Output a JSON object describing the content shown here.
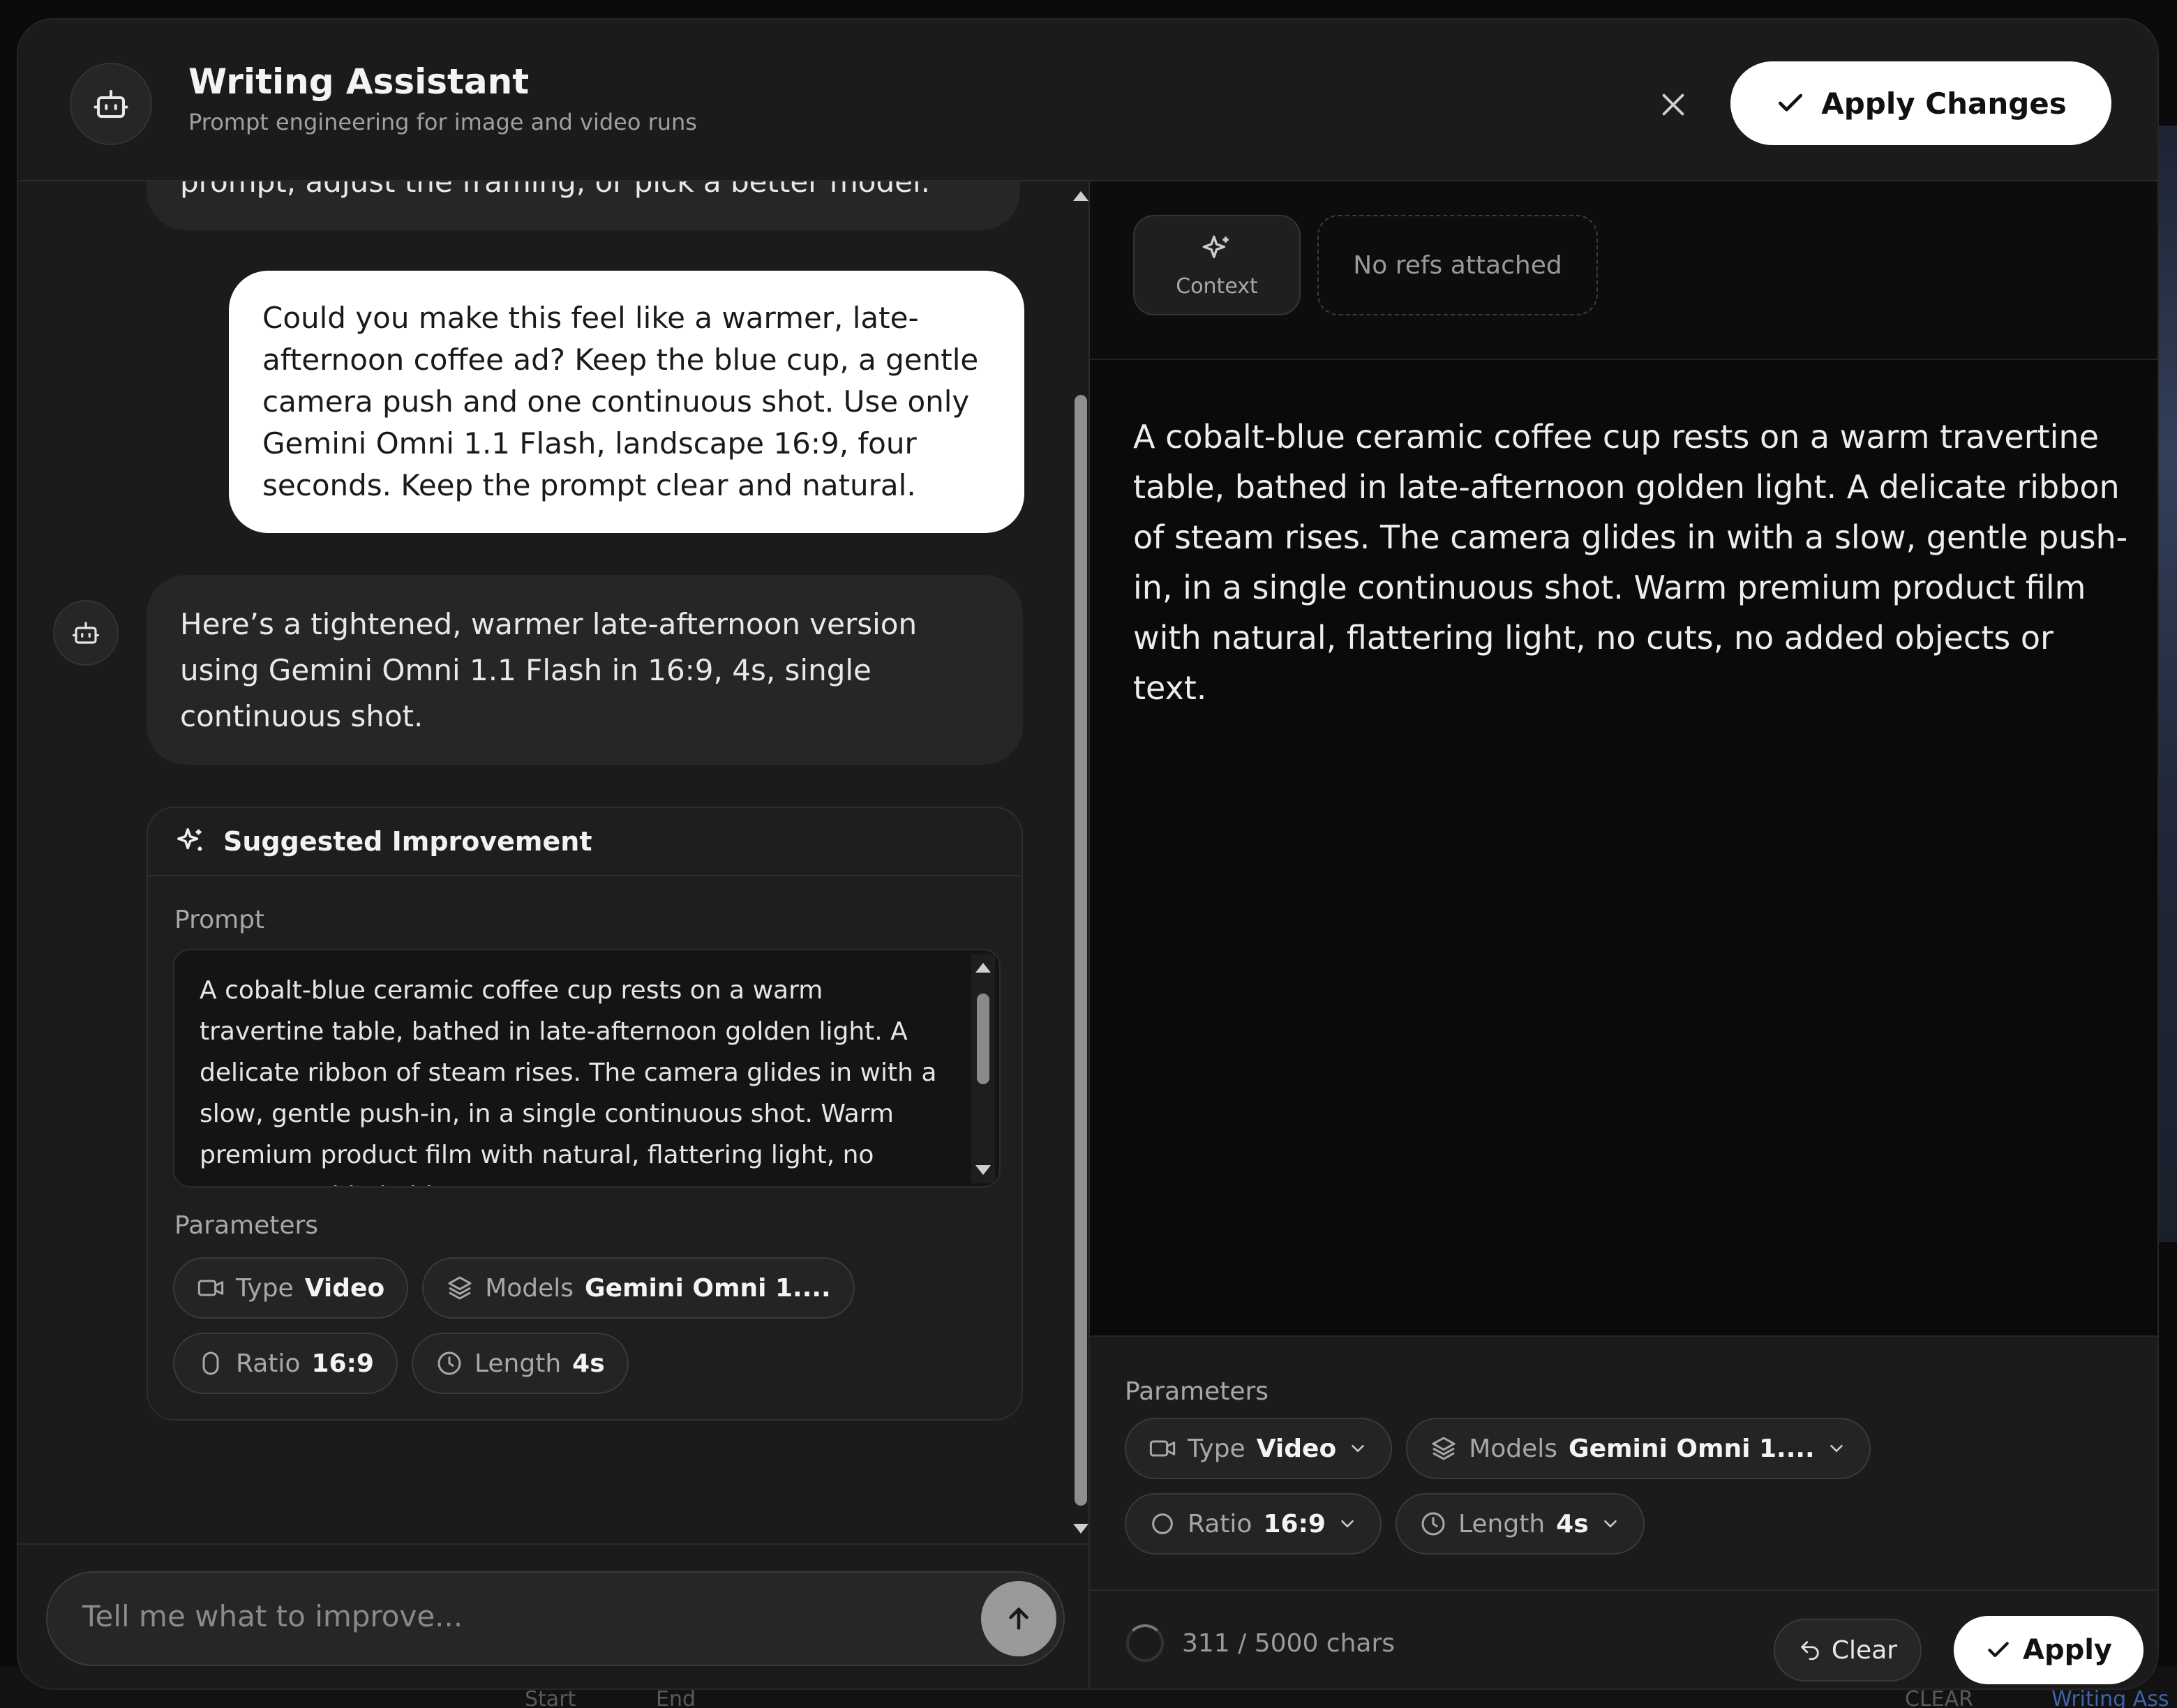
{
  "background": {
    "bottom_items": [
      "Start",
      "End",
      "CLEAR",
      "Writing Ass"
    ]
  },
  "header": {
    "title": "Writing Assistant",
    "subtitle": "Prompt engineering for image and video runs",
    "icon": "robot-icon",
    "close_icon": "close-icon",
    "apply_changes_label": "Apply Changes"
  },
  "chat": {
    "previous_message_tail": "prompt, adjust the framing, or pick a better model.",
    "user_message": "Could you make this feel like a warmer, late-afternoon coffee ad? Keep the blue cup, a gentle camera push and one continuous shot. Use only Gemini Omni 1.1 Flash, landscape 16:9, four seconds. Keep the prompt clear and natural.",
    "assistant_message": "Here’s a tightened, warmer late-afternoon version using Gemini Omni 1.1 Flash in 16:9, 4s, single continuous shot.",
    "suggestion": {
      "title": "Suggested Improvement",
      "prompt_label": "Prompt",
      "prompt_text": "A cobalt-blue ceramic coffee cup rests on a warm travertine table, bathed in late-afternoon golden light. A delicate ribbon of steam rises. The camera glides in with a slow, gentle push-in, in a single continuous shot. Warm premium product film with natural, flattering light, no cuts, no added objects or text.",
      "parameters_label": "Parameters",
      "params": {
        "type_label": "Type",
        "type_value": "Video",
        "models_label": "Models",
        "models_value": "Gemini Omni 1....",
        "ratio_label": "Ratio",
        "ratio_value": "16:9",
        "length_label": "Length",
        "length_value": "4s"
      }
    },
    "input_placeholder": "Tell me what to improve..."
  },
  "editor": {
    "context_label": "Context",
    "refs_label": "No refs attached",
    "prompt_text": "A cobalt-blue ceramic coffee cup rests on a warm travertine table, bathed in late-afternoon golden light. A delicate ribbon of steam rises. The camera glides in with a slow, gentle push-in, in a single continuous shot. Warm premium product film with natural, flattering light, no cuts, no added objects or text.",
    "parameters_label": "Parameters",
    "params": {
      "type_label": "Type",
      "type_value": "Video",
      "models_label": "Models",
      "models_value": "Gemini Omni 1....",
      "ratio_label": "Ratio",
      "ratio_value": "16:9",
      "length_label": "Length",
      "length_value": "4s"
    },
    "char_count": "311 / 5000 chars",
    "clear_label": "Clear",
    "apply_label": "Apply"
  },
  "colors": {
    "modal_bg": "#1b1b1b",
    "editor_bg": "#0a0a0a",
    "primary_button": "#ffffff",
    "text": "#ededed",
    "muted_text": "#a8a8a8"
  }
}
